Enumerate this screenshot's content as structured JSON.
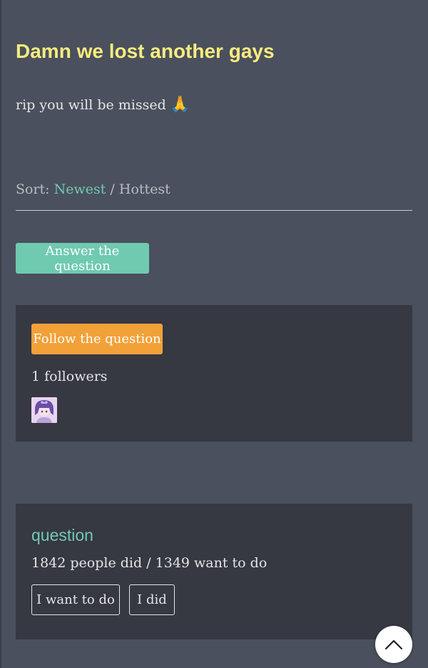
{
  "post": {
    "title": "Damn we lost another gays",
    "body": "rip you will be missed",
    "body_emoji": "🙏"
  },
  "sort": {
    "label": "Sort:",
    "newest": "Newest",
    "separator": " / ",
    "hottest": "Hottest",
    "active": "Newest"
  },
  "answer_button": "Answer the question",
  "follow": {
    "button": "Follow the question",
    "followers_text": "1 followers"
  },
  "stats": {
    "title": "question",
    "summary": "1842 people did / 1349 want to do",
    "want_button": "I want to do",
    "did_button": "I did"
  },
  "colors": {
    "background": "#4a505d",
    "card": "#363842",
    "accent_green": "#6fcab0",
    "accent_orange": "#f2a138",
    "title_yellow": "#f6ec7e"
  },
  "icons": {
    "emoji": "folded-hands-emoji",
    "avatar": "user-avatar",
    "scroll_top": "chevron-up-icon"
  }
}
